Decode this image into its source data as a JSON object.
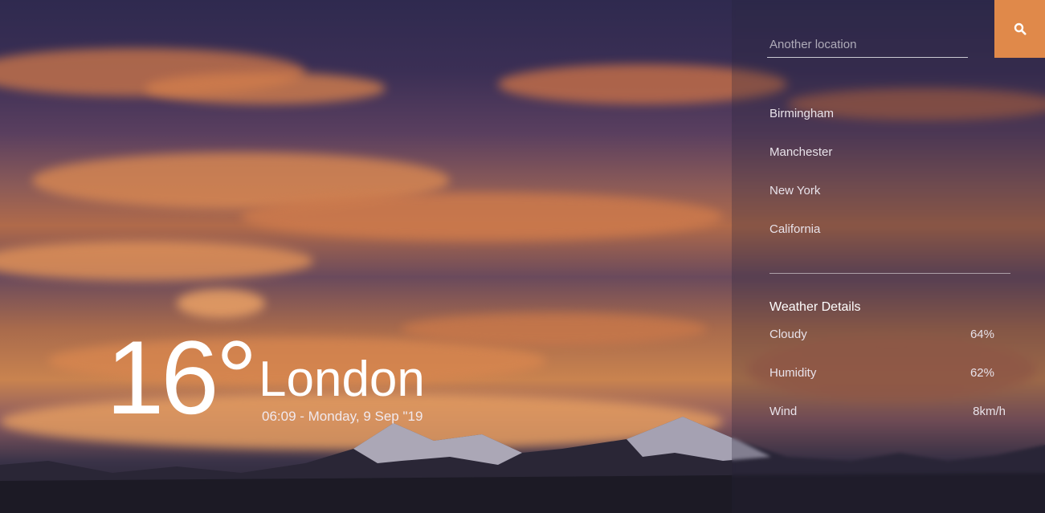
{
  "current": {
    "temperature": "16°",
    "city": "London",
    "datetime": "06:09 - Monday, 9 Sep \"19"
  },
  "search": {
    "placeholder": "Another location",
    "button_icon": "search-icon"
  },
  "locations": [
    "Birmingham",
    "Manchester",
    "New York",
    "California"
  ],
  "details": {
    "title": "Weather Details",
    "rows": [
      {
        "label": "Cloudy",
        "value": "64%"
      },
      {
        "label": "Humidity",
        "value": "62%"
      },
      {
        "label": "Wind",
        "value": "8km/h"
      }
    ]
  },
  "colors": {
    "accent": "#e0894a"
  }
}
